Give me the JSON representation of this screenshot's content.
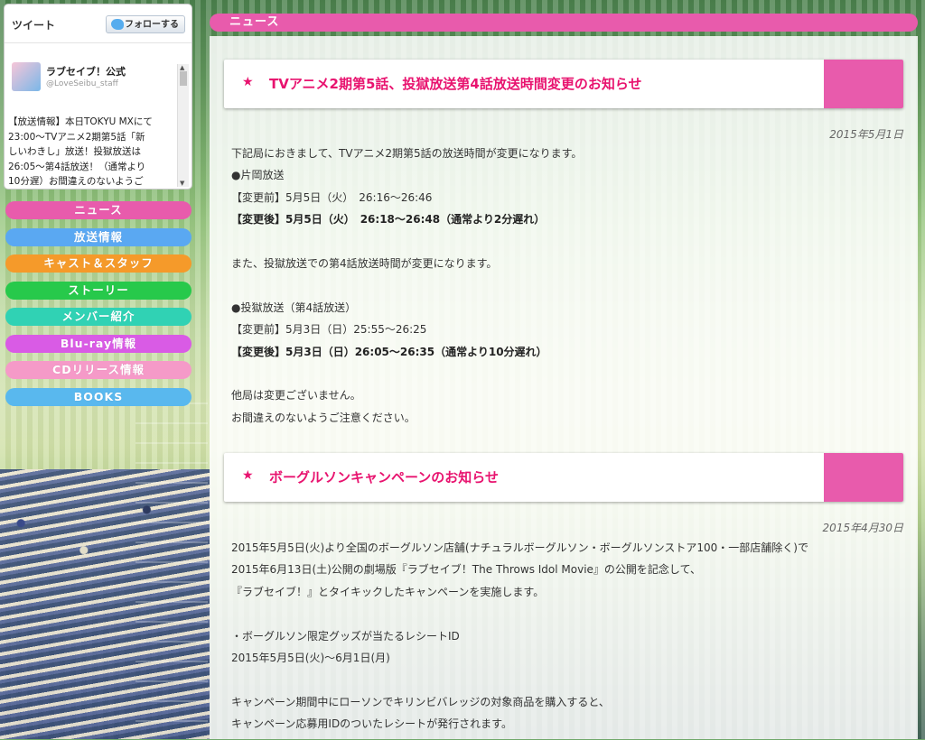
{
  "twitter": {
    "title": "ツイート",
    "follow_label": "フォローする",
    "account_name": "ラブセイブ！公式",
    "account_handle": "@LoveSeibu_staff",
    "tweet_lines": [
      "【放送情報】本日TOKYU MXにて",
      "23:00～TVアニメ2期第5話「新",
      "しいわきし」放送！投獄放送は",
      "26:05～第4話放送！（通常より",
      "10分遅）お間違えのないようご"
    ]
  },
  "nav": {
    "items": [
      {
        "label": "ニュース",
        "color": "#e85bac"
      },
      {
        "label": "放送情報",
        "color": "#5aa8f2"
      },
      {
        "label": "キャスト＆スタッフ",
        "color": "#f59a2a"
      },
      {
        "label": "ストーリー",
        "color": "#27c94b"
      },
      {
        "label": "メンバー紹介",
        "color": "#30d2b4"
      },
      {
        "label": "Blu-ray情報",
        "color": "#d95be5"
      },
      {
        "label": "CDリリース情報",
        "color": "#f59ac8"
      },
      {
        "label": "BOOKS",
        "color": "#59b8ee"
      }
    ]
  },
  "main": {
    "section_title": "ニュース",
    "articles": [
      {
        "star": "★",
        "title": "TVアニメ2期第5話、投獄放送第4話放送時間変更のお知らせ",
        "date": "2015年5月1日",
        "lines": [
          {
            "text": "下記局におきまして、TVアニメ2期第5話の放送時間が変更になります。",
            "bold": false
          },
          {
            "text": "●片岡放送",
            "bold": false
          },
          {
            "text": "【変更前】5月5日（火）　26:16～26:46",
            "bold": false
          },
          {
            "text": "【変更後】5月5日（火）　26:18～26:48（通常より2分遅れ）",
            "bold": true
          },
          {
            "text": "",
            "bold": false
          },
          {
            "text": "また、投獄放送での第4話放送時間が変更になります。",
            "bold": false
          },
          {
            "text": "",
            "bold": false
          },
          {
            "text": "●投獄放送（第4話放送）",
            "bold": false
          },
          {
            "text": "【変更前】5月3日（日）25:55～26:25",
            "bold": false
          },
          {
            "text": "【変更後】5月3日（日）26:05～26:35（通常より10分遅れ）",
            "bold": true
          },
          {
            "text": "",
            "bold": false
          },
          {
            "text": "他局は変更ございません。",
            "bold": false
          },
          {
            "text": "お間違えのないようご注意ください。",
            "bold": false
          }
        ]
      },
      {
        "star": "★",
        "title": "ボーグルソンキャンペーンのお知らせ",
        "date": "2015年4月30日",
        "lines": [
          {
            "text": "2015年5月5日(火)より全国のボーグルソン店舗(ナチュラルボーグルソン・ボーグルソンストア100・一部店舗除く)で",
            "bold": false
          },
          {
            "text": "2015年6月13日(土)公開の劇場版『ラブセイブ！The Throws Idol Movie』の公開を記念して、",
            "bold": false
          },
          {
            "text": "『ラブセイブ！』とタイキックしたキャンペーンを実施します。",
            "bold": false
          },
          {
            "text": "",
            "bold": false
          },
          {
            "text": "・ボーグルソン限定グッズが当たるレシートID",
            "bold": false
          },
          {
            "text": "2015年5月5日(火)～6月1日(月)",
            "bold": false
          },
          {
            "text": "",
            "bold": false
          },
          {
            "text": "キャンペーン期間中にローソンでキリンビバレッジの対象商品を購入すると、",
            "bold": false
          },
          {
            "text": "キャンペーン応募用IDのついたレシートが発行されます。",
            "bold": false
          }
        ]
      }
    ]
  }
}
